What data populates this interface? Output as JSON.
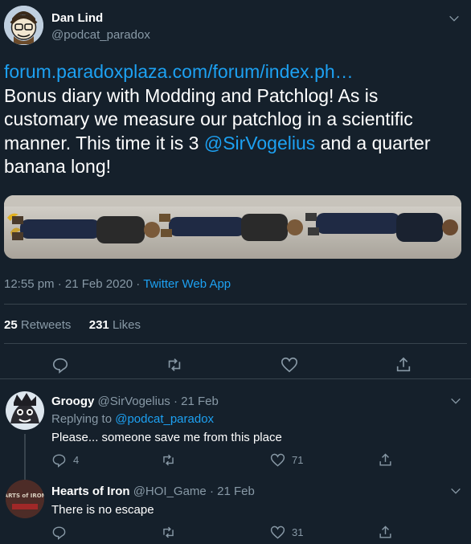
{
  "tweet": {
    "author_name": "Dan Lind",
    "author_handle": "@podcat_paradox",
    "link": "forum.paradoxplaza.com/forum/index.ph…",
    "text_before": "Bonus diary with Modding and Patchlog! As is customary we measure our patchlog in a scientific manner. This time it is 3 ",
    "mention": "@SirVogelius",
    "text_after": "  and a quarter banana long!",
    "time": "12:55 pm",
    "date": "21 Feb 2020",
    "source": "Twitter Web App",
    "retweets_count": "25",
    "retweets_label": "Retweets",
    "likes_count": "231",
    "likes_label": "Likes"
  },
  "replies": [
    {
      "author_name": "Groogy",
      "author_handle": "@SirVogelius",
      "date": "21 Feb",
      "replying_label": "Replying to ",
      "replying_to": "@podcat_paradox",
      "text": "Please... someone save me from this place",
      "reply_count": "4",
      "retweet_count": "",
      "like_count": "71"
    },
    {
      "author_name": "Hearts of Iron",
      "author_handle": "@HOI_Game",
      "date": "21 Feb",
      "text": "There is no escape",
      "avatar_text": "HEARTS of IRON IV",
      "reply_count": "",
      "retweet_count": "",
      "like_count": "31"
    }
  ],
  "colors": {
    "background": "#15202b",
    "accent": "#1da1f2",
    "secondary_text": "#8899a6",
    "divider": "#38444d"
  },
  "icons": [
    "chevron-down-icon",
    "reply-icon",
    "retweet-icon",
    "like-icon",
    "share-icon"
  ]
}
